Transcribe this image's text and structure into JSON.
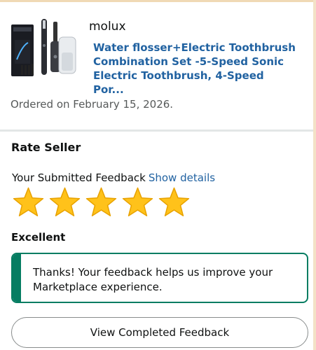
{
  "order": {
    "seller": "molux",
    "product_title": "Water flosser+Electric Toothbrush\nCombination Set -5-Speed Sonic\nElectric Toothbrush, 4-Speed Por...",
    "product_image_icon": "product-image-icon",
    "ordered_on": "Ordered on February 15, 2026."
  },
  "rate_seller": {
    "title": "Rate Seller",
    "submitted_label": "Your Submitted Feedback",
    "show_details": "Show details",
    "rating_stars": 5,
    "rating_max": 5,
    "rating_label": "Excellent",
    "star_color": "#ffc21a",
    "star_outline": "#e8a200"
  },
  "alert": {
    "message": "Thanks! Your feedback helps us improve your Marketplace experience.",
    "color": "#067d62"
  },
  "button": {
    "label": "View Completed Feedback"
  }
}
